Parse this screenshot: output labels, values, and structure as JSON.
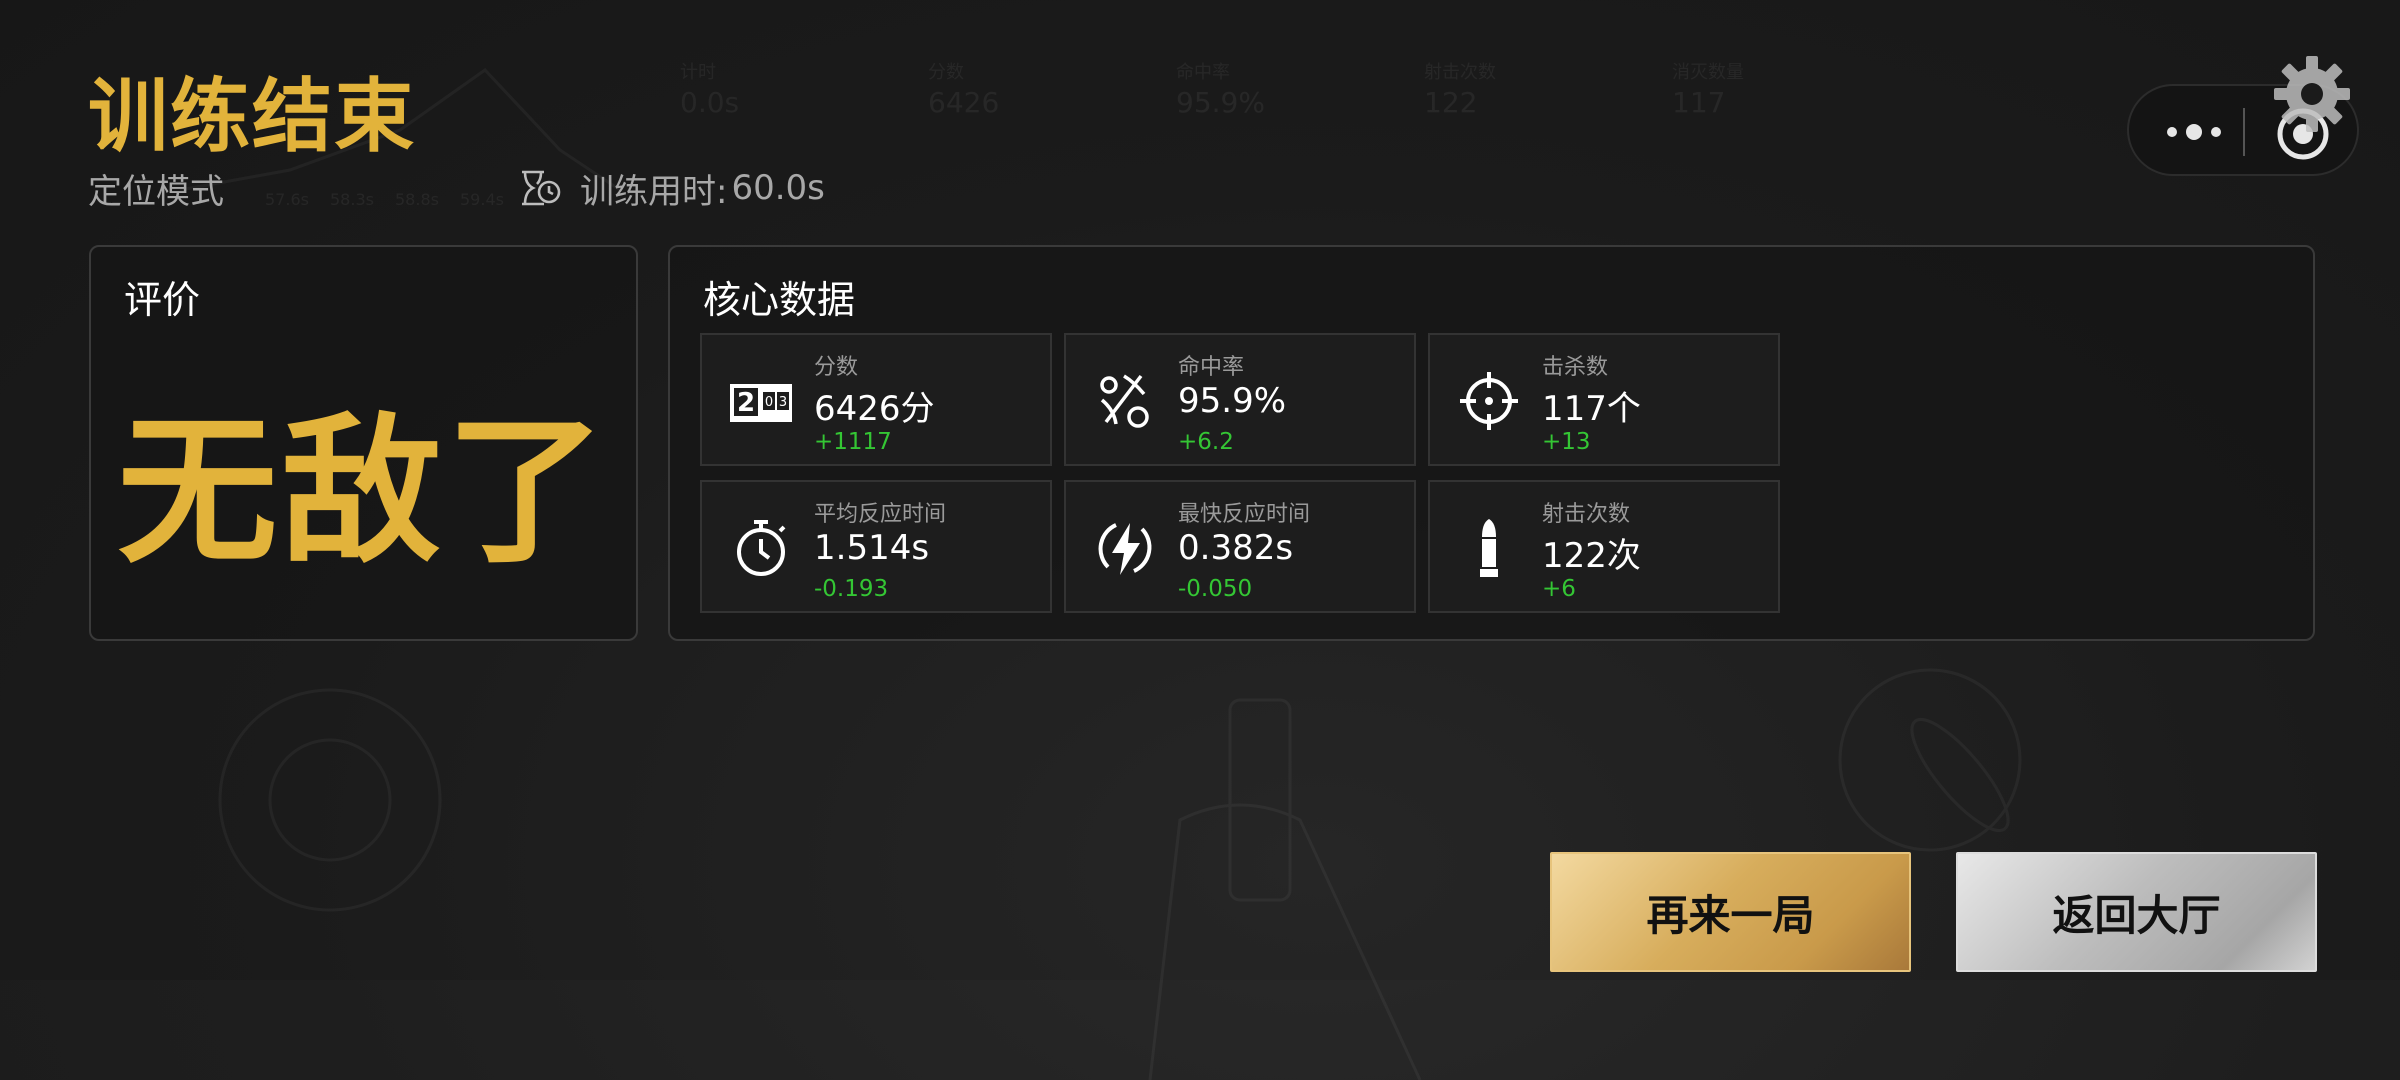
{
  "header": {
    "title": "训练结束",
    "mode": "定位模式",
    "time_label": "训练用时:",
    "time_value": "60.0s",
    "timer_icon": "hourglass-clock-icon"
  },
  "capsule": {
    "more_icon": "more-dots-icon",
    "close_icon": "circle-target-icon"
  },
  "settings": {
    "icon": "gear-icon"
  },
  "evaluation": {
    "title": "评价",
    "rating": "无敌了"
  },
  "core": {
    "title": "核心数据",
    "stats": [
      {
        "label": "分数",
        "value": "6426分",
        "delta": "+1117",
        "icon": "scoreboard-icon"
      },
      {
        "label": "命中率",
        "value": "95.9%",
        "delta": "+6.2",
        "icon": "hit-rate-icon"
      },
      {
        "label": "击杀数",
        "value": "117个",
        "delta": "+13",
        "icon": "crosshair-icon"
      },
      {
        "label": "平均反应时间",
        "value": "1.514s",
        "delta": "-0.193",
        "icon": "stopwatch-icon"
      },
      {
        "label": "最快反应时间",
        "value": "0.382s",
        "delta": "-0.050",
        "icon": "lightning-icon"
      },
      {
        "label": "射击次数",
        "value": "122次",
        "delta": "+6",
        "icon": "bullet-icon"
      }
    ]
  },
  "buttons": {
    "again": "再来一局",
    "lobby": "返回大厅"
  },
  "background_hud": [
    {
      "label": "计时",
      "value": "0.0s"
    },
    {
      "label": "分数",
      "value": "6426"
    },
    {
      "label": "命中率",
      "value": "95.9%"
    },
    {
      "label": "射击次数",
      "value": "122"
    },
    {
      "label": "消灭数量",
      "value": "117"
    }
  ],
  "background_chart_ticks": [
    "57.6s",
    "58.3s",
    "58.8s",
    "59.4s"
  ],
  "colors": {
    "accent_gold": "#e2b33b",
    "delta_green": "#34c634",
    "background": "#1b1b1b"
  }
}
